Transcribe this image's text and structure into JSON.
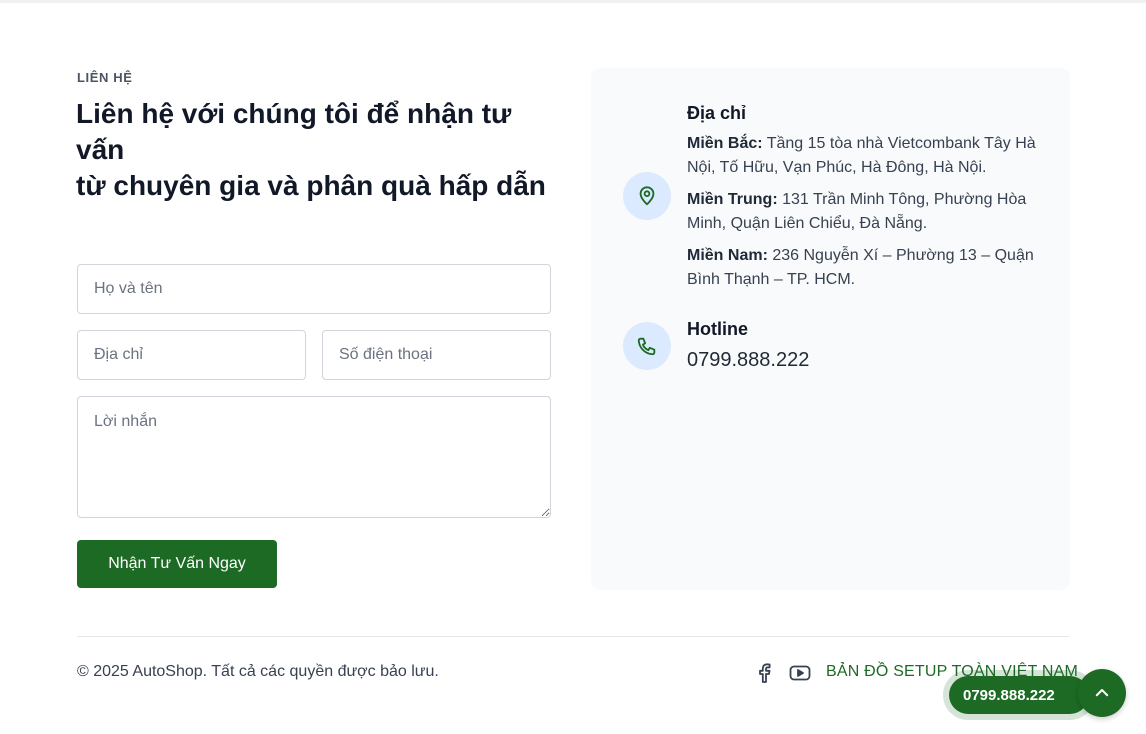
{
  "contact": {
    "kicker": "LIÊN HỆ",
    "title_lines": [
      "Liên hệ với chúng tôi để nhận tư vấn",
      "từ chuyên gia và phân quà hấp dẫn"
    ],
    "form": {
      "name_placeholder": "Họ và tên",
      "address_placeholder": "Địa chỉ",
      "phone_placeholder": "Số điện thoại",
      "message_placeholder": "Lời nhắn",
      "submit_label": "Nhận Tư Vấn Ngay"
    }
  },
  "info": {
    "address_title": "Địa chỉ",
    "addresses": [
      {
        "region": "Miền Bắc:",
        "text": " Tầng 15 tòa nhà Vietcombank Tây Hà Nội, Tố Hữu, Vạn Phúc, Hà Đông, Hà Nội."
      },
      {
        "region": "Miền Trung:",
        "text": " 131 Trần Minh Tông, Phường Hòa Minh, Quận Liên Chiểu, Đà Nẵng."
      },
      {
        "region": "Miền Nam:",
        "text": " 236 Nguyễn Xí – Phường 13 – Quận Bình Thạnh – TP. HCM."
      }
    ],
    "hotline_title": "Hotline",
    "hotline_number": "0799.888.222",
    "icons": {
      "address": "map-pin-icon",
      "hotline": "phone-icon"
    }
  },
  "footer": {
    "copyright": "© 2025 AutoShop. Tất cả các quyền được bảo lưu.",
    "social_icons": [
      "facebook-icon",
      "youtube-icon"
    ],
    "map_link": "BẢN ĐỒ SETUP TOÀN VIỆT NAM"
  },
  "floating": {
    "call_number": "0799.888.222",
    "scroll_top_icon": "chevron-up-icon"
  },
  "colors": {
    "brand_green": "#1d6a25",
    "panel_bg": "#f9fafb",
    "icon_bg": "#dbeafe"
  }
}
